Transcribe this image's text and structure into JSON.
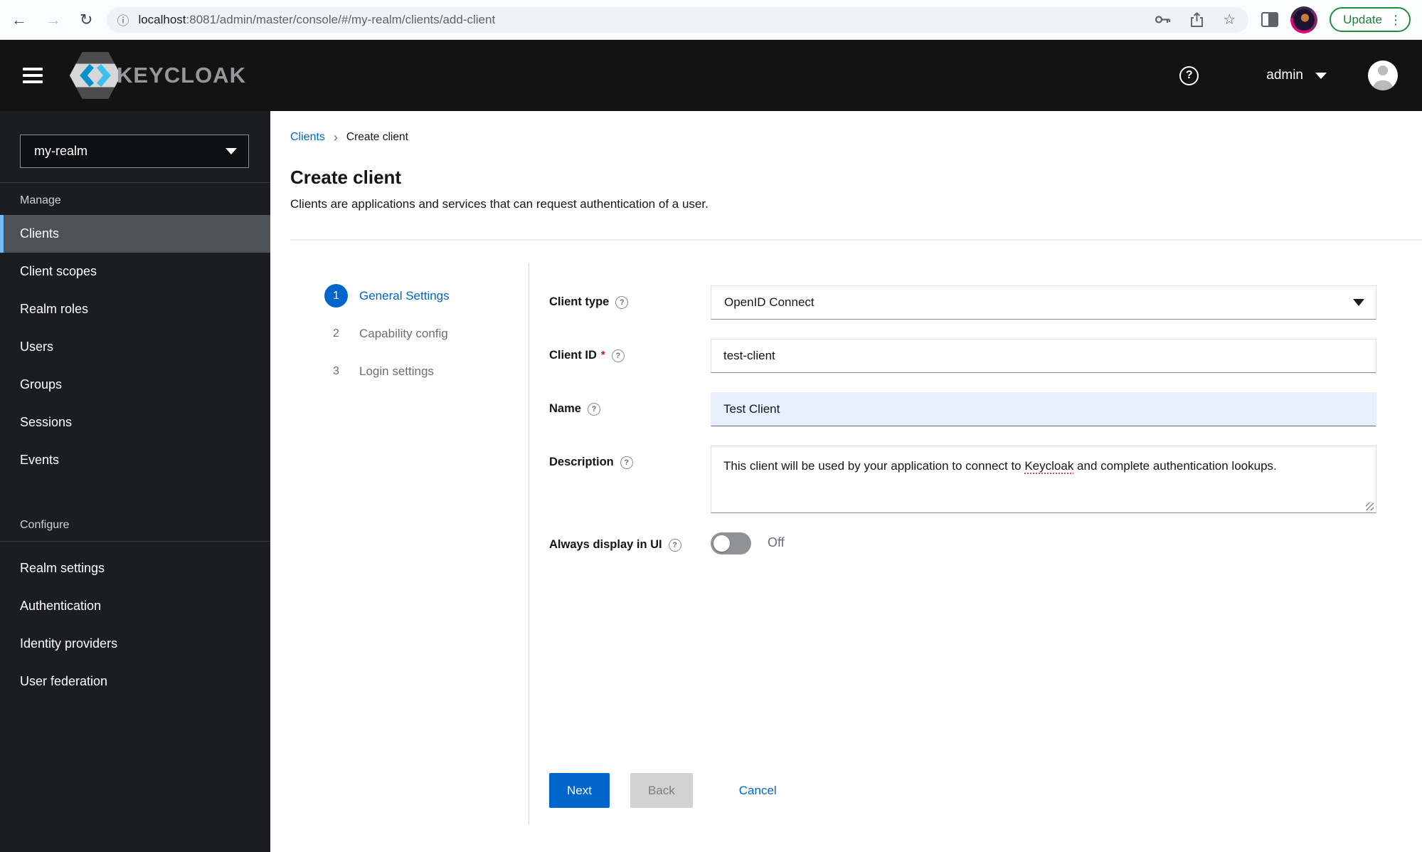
{
  "browser": {
    "url_host": "localhost",
    "url_path": ":8081/admin/master/console/#/my-realm/clients/add-client",
    "update_label": "Update"
  },
  "icons": {
    "back": "←",
    "forward": "→",
    "reload": "↻",
    "info": "ⓘ",
    "star": "☆",
    "kebab": "⋮",
    "help_question": "?",
    "breadcrumb_chevron": "›"
  },
  "masthead": {
    "brand": "KEYCLOAK",
    "user": "admin"
  },
  "sidebar": {
    "realm": "my-realm",
    "manage_label": "Manage",
    "manage_items": [
      "Clients",
      "Client scopes",
      "Realm roles",
      "Users",
      "Groups",
      "Sessions",
      "Events"
    ],
    "active_item": "Clients",
    "configure_label": "Configure",
    "configure_items": [
      "Realm settings",
      "Authentication",
      "Identity providers",
      "User federation"
    ]
  },
  "breadcrumb": {
    "parent": "Clients",
    "current": "Create client"
  },
  "page": {
    "title": "Create client",
    "subtitle": "Clients are applications and services that can request authentication of a user."
  },
  "wizard": {
    "steps": [
      {
        "num": "1",
        "label": "General Settings"
      },
      {
        "num": "2",
        "label": "Capability config"
      },
      {
        "num": "3",
        "label": "Login settings"
      }
    ]
  },
  "form": {
    "client_type": {
      "label": "Client type",
      "value": "OpenID Connect"
    },
    "client_id": {
      "label": "Client ID",
      "required": "*",
      "value": "test-client"
    },
    "name": {
      "label": "Name",
      "value": "Test Client"
    },
    "description": {
      "label": "Description",
      "text_before": "This client will be used by your application to connect to ",
      "text_highlight": "Keycloak",
      "text_after": " and complete authentication lookups."
    },
    "always_display": {
      "label": "Always display in UI",
      "state": "Off"
    }
  },
  "actions": {
    "next": "Next",
    "back": "Back",
    "cancel": "Cancel"
  },
  "colors": {
    "primary": "#0066cc",
    "masthead_bg": "#131313",
    "sidebar_bg": "#1b1d21",
    "nav_active_bg": "#4d5258",
    "nav_accent": "#73bcf7",
    "autofill_bg": "#e8f0fe",
    "update_green": "#1e8e3e"
  }
}
